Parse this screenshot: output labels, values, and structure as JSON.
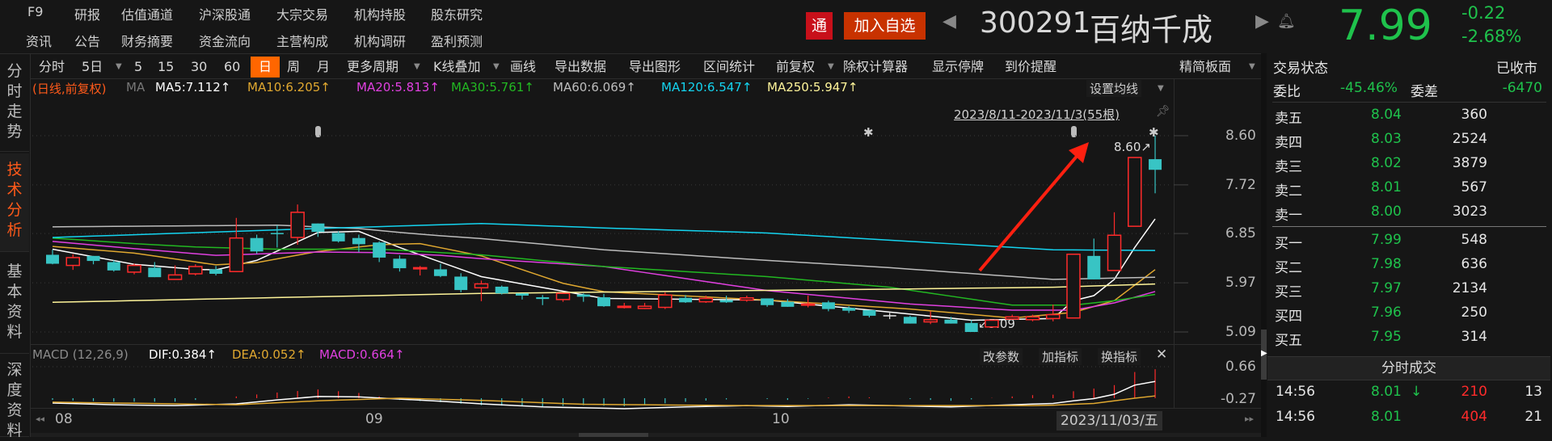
{
  "top_nav": {
    "row1": [
      "F9",
      "研报",
      "估值通道",
      "沪深股通",
      "大宗交易",
      "机构持股",
      "股东研究"
    ],
    "row2": [
      "资讯",
      "公告",
      "财务摘要",
      "资金流向",
      "主营构成",
      "机构调研",
      "盈利预测"
    ]
  },
  "stock": {
    "tong_badge": "通",
    "add_watch": "加入自选",
    "code": "300291",
    "name": "百纳千成",
    "price": "7.99",
    "change": "-0.22",
    "change_pct": "-2.68%"
  },
  "sidebar": [
    {
      "label": "分时走势",
      "active": false
    },
    {
      "label": "技术分析",
      "active": true
    },
    {
      "label": "基本资料",
      "active": false
    },
    {
      "label": "深度资料",
      "active": false
    }
  ],
  "toolbar": {
    "items": [
      "分时",
      "5日",
      "5",
      "15",
      "30",
      "60",
      "日",
      "周",
      "月",
      "更多周期",
      "K线叠加",
      "画线",
      "导出数据",
      "导出图形",
      "区间统计",
      "前复权",
      "除权计算器",
      "显示停牌",
      "到价提醒"
    ],
    "active": "日",
    "panel_mode": "精简板面"
  },
  "ma_legend": {
    "mode": "(日线,前复权)",
    "ma": "MA",
    "items": [
      "MA5:7.112↑",
      "MA10:6.205↑",
      "MA20:5.813↑",
      "MA30:5.761↑",
      "MA60:6.069↑",
      "MA120:6.547↑",
      "MA250:5.947↑"
    ],
    "set_ma": "设置均线"
  },
  "range_label": "2023/8/11-2023/11/3(55根)",
  "colors": {
    "up": "#ff2b2b",
    "down": "#38c4c4",
    "ma5": "#ffffff",
    "ma10": "#e0a830",
    "ma20": "#e040e0",
    "ma30": "#22b822",
    "ma60": "#bdbdbd",
    "ma120": "#14d4f0",
    "ma250": "#fff59a",
    "green": "#1fc24c",
    "red": "#ff2b2b",
    "accent": "#ff6600"
  },
  "chart_data": [
    {
      "type": "candlestick",
      "y_ticks": [
        "8.60",
        "7.72",
        "6.85",
        "5.97",
        "5.09"
      ],
      "ylim": [
        5.09,
        8.6
      ],
      "high_label": "8.60↗",
      "low_label": "↙5.09",
      "x_ticks": [
        {
          "label": "08",
          "candle": 1
        },
        {
          "label": "09",
          "candle": 16
        },
        {
          "label": "10",
          "candle": 36
        }
      ],
      "candles_ohlc": [
        [
          6.47,
          6.56,
          6.3,
          6.31
        ],
        [
          6.28,
          6.48,
          6.2,
          6.42
        ],
        [
          6.45,
          6.45,
          6.3,
          6.36
        ],
        [
          6.34,
          6.37,
          6.17,
          6.19
        ],
        [
          6.16,
          6.31,
          6.12,
          6.28
        ],
        [
          6.24,
          6.34,
          6.07,
          6.07
        ],
        [
          6.03,
          6.28,
          6.03,
          6.11
        ],
        [
          6.13,
          6.3,
          6.1,
          6.26
        ],
        [
          6.21,
          6.27,
          6.1,
          6.13
        ],
        [
          6.17,
          7.13,
          6.16,
          6.77
        ],
        [
          6.77,
          6.83,
          6.49,
          6.53
        ],
        [
          6.86,
          7.0,
          6.6,
          6.84
        ],
        [
          6.78,
          7.37,
          6.65,
          7.23
        ],
        [
          7.03,
          7.03,
          6.79,
          6.88
        ],
        [
          6.86,
          6.89,
          6.69,
          6.71
        ],
        [
          6.77,
          6.83,
          6.52,
          6.66
        ],
        [
          6.69,
          6.71,
          6.34,
          6.42
        ],
        [
          6.4,
          6.46,
          6.17,
          6.23
        ],
        [
          6.22,
          6.27,
          6.1,
          6.24
        ],
        [
          6.21,
          6.31,
          6.07,
          6.09
        ],
        [
          6.08,
          6.14,
          5.8,
          5.84
        ],
        [
          5.88,
          6.01,
          5.64,
          5.95
        ],
        [
          5.9,
          5.92,
          5.76,
          5.78
        ],
        [
          5.78,
          5.78,
          5.67,
          5.74
        ],
        [
          5.71,
          5.75,
          5.57,
          5.68
        ],
        [
          5.67,
          5.78,
          5.63,
          5.78
        ],
        [
          5.76,
          5.78,
          5.63,
          5.72
        ],
        [
          5.71,
          5.77,
          5.54,
          5.55
        ],
        [
          5.53,
          5.61,
          5.51,
          5.55
        ],
        [
          5.51,
          5.61,
          5.5,
          5.55
        ],
        [
          5.53,
          5.8,
          5.5,
          5.75
        ],
        [
          5.7,
          5.75,
          5.61,
          5.62
        ],
        [
          5.63,
          5.74,
          5.61,
          5.69
        ],
        [
          5.66,
          5.74,
          5.61,
          5.62
        ],
        [
          5.66,
          5.74,
          5.63,
          5.7
        ],
        [
          5.69,
          5.69,
          5.54,
          5.57
        ],
        [
          5.63,
          5.68,
          5.54,
          5.54
        ],
        [
          5.57,
          5.74,
          5.53,
          5.59
        ],
        [
          5.62,
          5.65,
          5.46,
          5.5
        ],
        [
          5.52,
          5.55,
          5.43,
          5.47
        ],
        [
          5.48,
          5.48,
          5.35,
          5.38
        ],
        [
          5.39,
          5.43,
          5.32,
          5.39
        ],
        [
          5.36,
          5.38,
          5.24,
          5.24
        ],
        [
          5.27,
          5.46,
          5.23,
          5.31
        ],
        [
          5.31,
          5.36,
          5.24,
          5.24
        ],
        [
          5.25,
          5.3,
          5.09,
          5.09
        ],
        [
          5.18,
          5.3,
          5.18,
          5.3
        ],
        [
          5.32,
          5.4,
          5.31,
          5.36
        ],
        [
          5.31,
          5.4,
          5.28,
          5.36
        ],
        [
          5.33,
          5.58,
          5.28,
          5.4
        ],
        [
          5.34,
          6.48,
          5.34,
          6.48
        ],
        [
          6.45,
          6.76,
          6.03,
          6.03
        ],
        [
          6.19,
          7.23,
          6.19,
          6.82
        ],
        [
          6.98,
          8.21,
          6.98,
          8.21
        ],
        [
          8.18,
          8.6,
          7.57,
          7.99
        ]
      ],
      "moving_averages": {
        "ma5": [
          [
            1,
            6.57
          ],
          [
            5,
            6.3
          ],
          [
            8,
            6.21
          ],
          [
            9,
            6.2
          ],
          [
            11,
            6.37
          ],
          [
            14,
            6.87
          ],
          [
            16,
            6.89
          ],
          [
            18,
            6.6
          ],
          [
            22,
            6.08
          ],
          [
            28,
            5.69
          ],
          [
            36,
            5.66
          ],
          [
            43,
            5.41
          ],
          [
            46,
            5.3
          ],
          [
            50,
            5.33
          ],
          [
            51,
            5.65
          ],
          [
            52,
            5.74
          ],
          [
            53,
            6.03
          ],
          [
            54,
            6.6
          ],
          [
            55,
            7.112
          ]
        ],
        "ma10": [
          [
            1,
            6.62
          ],
          [
            5,
            6.5
          ],
          [
            9,
            6.29
          ],
          [
            11,
            6.33
          ],
          [
            14,
            6.53
          ],
          [
            17,
            6.65
          ],
          [
            19,
            6.67
          ],
          [
            22,
            6.45
          ],
          [
            26,
            5.96
          ],
          [
            28,
            5.81
          ],
          [
            36,
            5.66
          ],
          [
            43,
            5.5
          ],
          [
            48,
            5.34
          ],
          [
            51,
            5.44
          ],
          [
            53,
            5.65
          ],
          [
            55,
            6.205
          ]
        ],
        "ma20": [
          [
            1,
            6.71
          ],
          [
            5,
            6.58
          ],
          [
            9,
            6.46
          ],
          [
            14,
            6.52
          ],
          [
            17,
            6.51
          ],
          [
            20,
            6.46
          ],
          [
            22,
            6.4
          ],
          [
            28,
            6.26
          ],
          [
            36,
            5.83
          ],
          [
            43,
            5.59
          ],
          [
            48,
            5.48
          ],
          [
            51,
            5.48
          ],
          [
            53,
            5.61
          ],
          [
            55,
            5.813
          ]
        ],
        "ma30": [
          [
            1,
            6.77
          ],
          [
            5,
            6.67
          ],
          [
            8,
            6.61
          ],
          [
            12,
            6.57
          ],
          [
            17,
            6.57
          ],
          [
            22,
            6.47
          ],
          [
            28,
            6.26
          ],
          [
            36,
            6.08
          ],
          [
            42,
            5.89
          ],
          [
            48,
            5.57
          ],
          [
            51,
            5.57
          ],
          [
            53,
            5.65
          ],
          [
            55,
            5.761
          ]
        ],
        "ma60": [
          [
            1,
            6.97
          ],
          [
            12,
            7.0
          ],
          [
            16,
            6.94
          ],
          [
            18,
            6.87
          ],
          [
            20,
            6.81
          ],
          [
            22,
            6.76
          ],
          [
            28,
            6.56
          ],
          [
            36,
            6.37
          ],
          [
            42,
            6.24
          ],
          [
            50,
            6.03
          ],
          [
            55,
            6.069
          ]
        ],
        "ma120": [
          [
            1,
            6.78
          ],
          [
            10,
            6.89
          ],
          [
            14,
            6.94
          ],
          [
            22,
            7.03
          ],
          [
            28,
            6.95
          ],
          [
            36,
            6.86
          ],
          [
            43,
            6.71
          ],
          [
            50,
            6.56
          ],
          [
            55,
            6.547
          ]
        ],
        "ma250": [
          [
            1,
            5.62
          ],
          [
            10,
            5.69
          ],
          [
            18,
            5.75
          ],
          [
            22,
            5.78
          ],
          [
            43,
            5.86
          ],
          [
            50,
            5.89
          ],
          [
            55,
            5.947
          ]
        ]
      }
    },
    {
      "type": "macd",
      "title": "MACD (12,26,9)",
      "legend": [
        "DIF:0.384↑",
        "DEA:0.052↑",
        "MACD:0.664↑"
      ],
      "y_ticks": [
        "0.66",
        "-0.27"
      ],
      "dif": [
        [
          1,
          -0.11
        ],
        [
          4,
          -0.15
        ],
        [
          7,
          -0.17
        ],
        [
          10,
          -0.13
        ],
        [
          12,
          -0.04
        ],
        [
          14,
          0.04
        ],
        [
          16,
          0.03
        ],
        [
          18,
          -0.02
        ],
        [
          20,
          -0.07
        ],
        [
          22,
          -0.13
        ],
        [
          25,
          -0.2
        ],
        [
          29,
          -0.24
        ],
        [
          32,
          -0.2
        ],
        [
          35,
          -0.17
        ],
        [
          37,
          -0.19
        ],
        [
          40,
          -0.15
        ],
        [
          45,
          -0.2
        ],
        [
          48,
          -0.15
        ],
        [
          50,
          -0.12
        ],
        [
          51,
          -0.06
        ],
        [
          52,
          -0.01
        ],
        [
          53,
          0.09
        ],
        [
          54,
          0.3
        ],
        [
          55,
          0.384
        ]
      ],
      "dea": [
        [
          1,
          -0.09
        ],
        [
          10,
          -0.15
        ],
        [
          14,
          -0.06
        ],
        [
          18,
          0.0
        ],
        [
          22,
          -0.05
        ],
        [
          27,
          -0.14
        ],
        [
          35,
          -0.17
        ],
        [
          49,
          -0.17
        ],
        [
          50,
          -0.16
        ],
        [
          52,
          -0.12
        ],
        [
          53,
          -0.06
        ],
        [
          54,
          0.0
        ],
        [
          55,
          0.052
        ]
      ]
    }
  ],
  "macd_buttons": [
    "改参数",
    "加指标",
    "换指标"
  ],
  "date_tooltip": "2023/11/03/五",
  "order_book": {
    "status_label": "交易状态",
    "status": "已收市",
    "ratio_label": "委比",
    "ratio": "-45.46%",
    "diff_label": "委差",
    "diff": "-6470",
    "asks": [
      {
        "label": "卖五",
        "price": "8.04",
        "vol": "360"
      },
      {
        "label": "卖四",
        "price": "8.03",
        "vol": "2524"
      },
      {
        "label": "卖三",
        "price": "8.02",
        "vol": "3879"
      },
      {
        "label": "卖二",
        "price": "8.01",
        "vol": "567"
      },
      {
        "label": "卖一",
        "price": "8.00",
        "vol": "3023"
      }
    ],
    "bids": [
      {
        "label": "买一",
        "price": "7.99",
        "vol": "548"
      },
      {
        "label": "买二",
        "price": "7.98",
        "vol": "636"
      },
      {
        "label": "买三",
        "price": "7.97",
        "vol": "2134"
      },
      {
        "label": "买四",
        "price": "7.96",
        "vol": "250"
      },
      {
        "label": "买五",
        "price": "7.95",
        "vol": "314"
      }
    ]
  },
  "trades": {
    "title": "分时成交",
    "rows": [
      {
        "time": "14:56",
        "price": "8.01",
        "arrow": "↓",
        "vol": "210",
        "count": "13"
      },
      {
        "time": "14:56",
        "price": "8.01",
        "arrow": "",
        "vol": "404",
        "count": "21"
      }
    ]
  }
}
